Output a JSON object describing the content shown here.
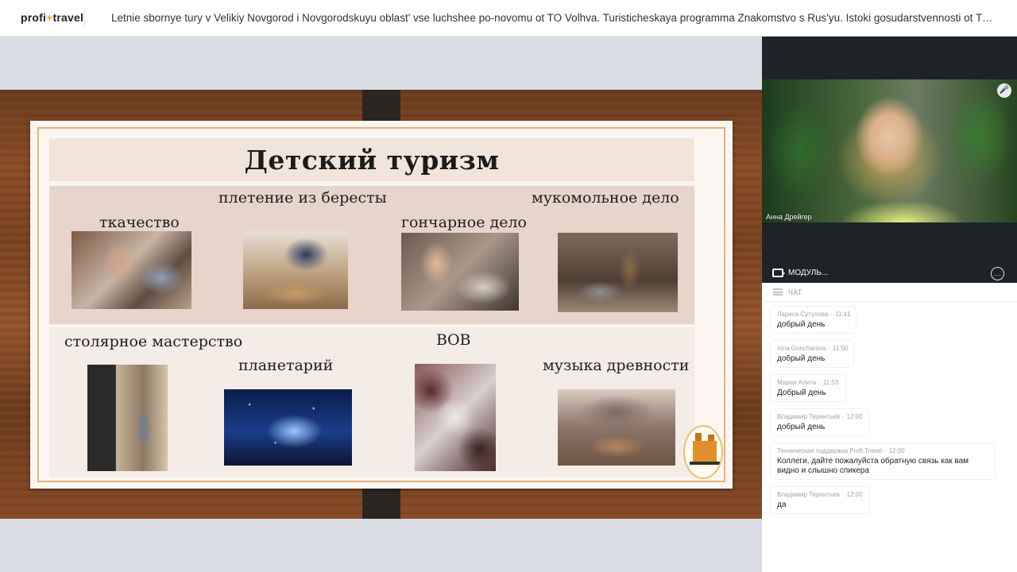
{
  "header": {
    "logo_left": "profi",
    "logo_plus": "+",
    "logo_right": "travel",
    "title": "Letnie sbornye tury v Velikiy Novgorod i Novgorodskuyu oblast' vse luchshee po-novomu ot TO Volhva. Turisticheskaya programma Znakomstvo s Rus'yu. Istoki gosudarstvennosti ot TO Elysion Tr…"
  },
  "slide": {
    "title": "Детский туризм",
    "labels": {
      "weaving": "ткачество",
      "birch_bark": "плетение из бересты",
      "pottery": "гончарное дело",
      "milling": "мукомольное дело",
      "carpentry": "столярное мастерство",
      "planetarium": "планетарий",
      "ww2": "ВОВ",
      "ancient_music": "музыка древности"
    }
  },
  "video": {
    "speaker_name": "Анна Дрейгер",
    "mic_icon": "microphone-icon",
    "module_label": "МОДУЛЬ..."
  },
  "chat": {
    "header_label": "ЧАТ",
    "messages": [
      {
        "author": "Лариса Сутулова",
        "time": "11:41",
        "text": "добрый день"
      },
      {
        "author": "Irina Goncharova",
        "time": "11:50",
        "text": "добрый день"
      },
      {
        "author": "Мария Алита",
        "time": "11:53",
        "text": "Добрый день"
      },
      {
        "author": "Владимир Терентьев",
        "time": "12:00",
        "text": "добрый день"
      },
      {
        "author": "Техническая поддержка Profi.Travel",
        "time": "12:00",
        "text": "Коллеги, дайте пожалуйста обратную связь как вам видно и слышно спикера"
      },
      {
        "author": "Владимир Терентьев",
        "time": "12:00",
        "text": "да"
      }
    ]
  },
  "colors": {
    "accent": "#f0a020",
    "video_panel_bg": "#1f2328",
    "slide_frame": "#e2b27d"
  }
}
